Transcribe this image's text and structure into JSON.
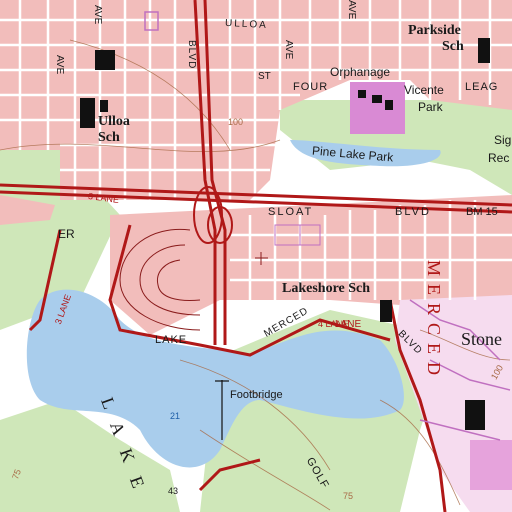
{
  "map": {
    "type": "topographic",
    "colors": {
      "urban": "#f2bdbb",
      "vegetation": "#cfe7b9",
      "water": "#a9cdec",
      "road_red": "#b01818",
      "purple_revision": "#c070c0",
      "contour": "#a86a46"
    },
    "labels": {
      "parkside": "Parkside",
      "parkside_sch": "Sch",
      "ulloa_st": "ULLOA",
      "ulloa_school": "Ulloa",
      "ulloa_sch": "Sch",
      "orphanage": "Orphanage",
      "four": "FOUR",
      "leag": "LEAG",
      "vicente": "Vicente",
      "park": "Park",
      "pine_lake_park": "Pine  Lake  Park",
      "sig": "Sig",
      "rec": "Rec",
      "sloat": "SLOAT",
      "blvd": "BLVD",
      "bm": "BM 15",
      "er": "ER",
      "lakeshore_sch": "Lakeshore Sch",
      "stone": "Stone",
      "merced_vertical": "MERCED",
      "lake_word": "LAKE",
      "lake_big": "L A K E",
      "merced_small": "MERCED",
      "lane": "LANE",
      "blvd2": "BLVD",
      "footbridge": "Footbridge",
      "golf": "GOLF",
      "three_lane_left": "3 LANE",
      "three_lane_top": "3 LANE",
      "four_lane": "4 LANE",
      "blvd_vertical": "BLVD",
      "ave1": "AVE",
      "ave2": "AVE",
      "ave3": "AVE",
      "ave4": "AVE",
      "st": "ST",
      "c100": "100",
      "c100b": "100",
      "num21": "21",
      "num43": "43",
      "num75": "75",
      "num75b": "75"
    }
  }
}
